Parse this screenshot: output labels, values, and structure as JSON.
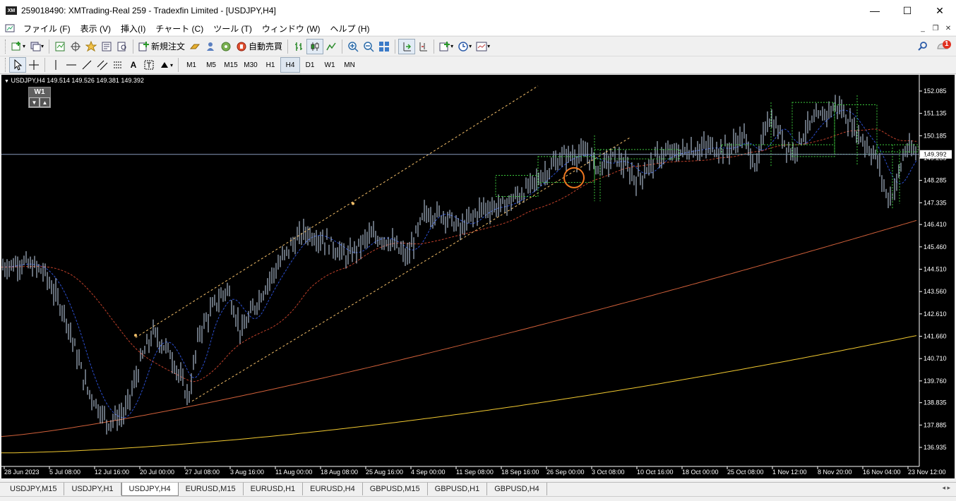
{
  "window": {
    "title": "259018490: XMTrading-Real 259 - Tradexfin Limited - [USDJPY,H4]",
    "app_icon_text": "XM",
    "controls": [
      "—",
      "☐",
      "✕"
    ]
  },
  "menu": {
    "items": [
      "ファイル (F)",
      "表示 (V)",
      "挿入(I)",
      "チャート (C)",
      "ツール (T)",
      "ウィンドウ (W)",
      "ヘルプ (H)"
    ],
    "mdi_controls": [
      "_",
      "❐",
      "✕"
    ]
  },
  "toolbar": {
    "new_order_label": "新規注文",
    "auto_trade_label": "自動売買",
    "notification_count": "1"
  },
  "timeframes": [
    "M1",
    "M5",
    "M15",
    "M30",
    "H1",
    "H4",
    "D1",
    "W1",
    "MN"
  ],
  "active_timeframe": "H4",
  "chart": {
    "header": "USDJPY,H4  149.514 149.526 149.381 149.392",
    "w1_label": "W1",
    "current_price": "149.392",
    "price_axis": [
      "152.085",
      "151.135",
      "150.185",
      "149.235",
      "148.285",
      "147.335",
      "146.410",
      "145.460",
      "144.510",
      "143.560",
      "142.610",
      "141.660",
      "140.710",
      "139.760",
      "138.835",
      "137.885",
      "136.935"
    ],
    "time_axis": [
      "28 Jun 2023",
      "5 Jul 08:00",
      "12 Jul 16:00",
      "20 Jul 00:00",
      "27 Jul 08:00",
      "3 Aug 16:00",
      "11 Aug 00:00",
      "18 Aug 08:00",
      "25 Aug 16:00",
      "4 Sep 00:00",
      "11 Sep 08:00",
      "18 Sep 16:00",
      "26 Sep 00:00",
      "3 Oct 08:00",
      "10 Oct 16:00",
      "18 Oct 00:00",
      "25 Oct 08:00",
      "1 Nov 12:00",
      "8 Nov 20:00",
      "16 Nov 04:00",
      "23 Nov 12:00"
    ],
    "colors": {
      "background": "#000000",
      "bars": "#c8daf0",
      "fast_ma": "#2b4fd0",
      "mid_ma": "#c0402a",
      "slow_ma": "#d0603a",
      "slowest_ma": "#f0c830",
      "channel": "#f5c06a",
      "boxes": "#3cc83c",
      "price_line": "#8899bb",
      "marker": "#f07820"
    }
  },
  "symbol_tabs": [
    "USDJPY,M15",
    "USDJPY,H1",
    "USDJPY,H4",
    "EURUSD,M15",
    "EURUSD,H1",
    "EURUSD,H4",
    "GBPUSD,M15",
    "GBPUSD,H1",
    "GBPUSD,H4"
  ],
  "active_tab": "USDJPY,H4"
}
